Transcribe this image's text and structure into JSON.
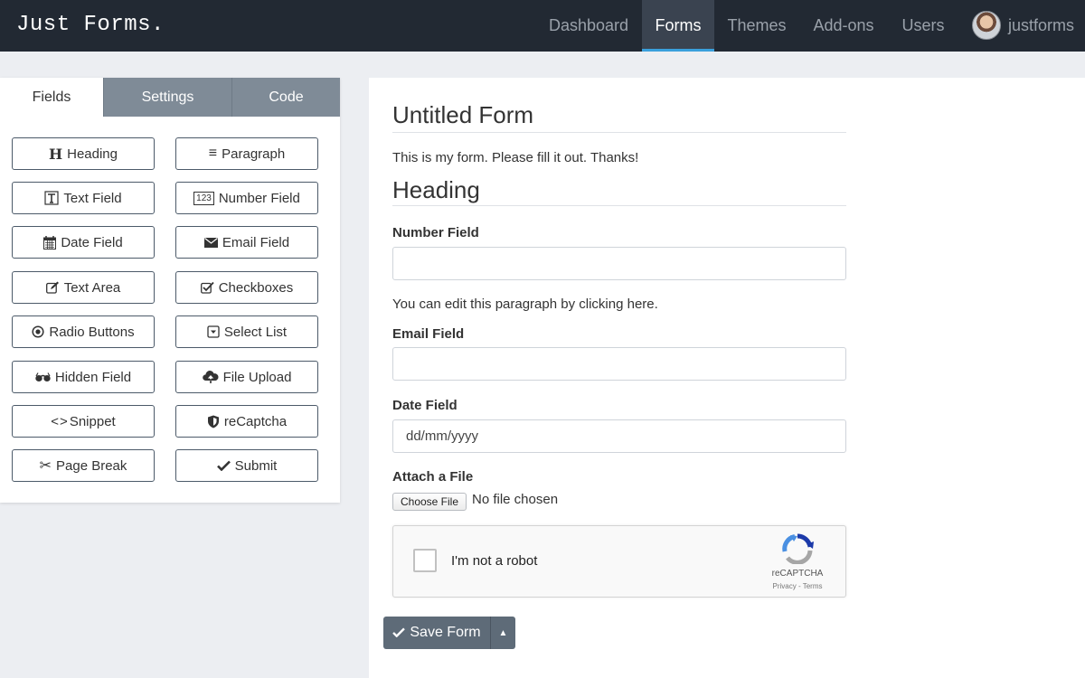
{
  "brand": "Just Forms.",
  "nav": {
    "items": [
      {
        "label": "Dashboard",
        "active": false
      },
      {
        "label": "Forms",
        "active": true
      },
      {
        "label": "Themes",
        "active": false
      },
      {
        "label": "Add-ons",
        "active": false
      },
      {
        "label": "Users",
        "active": false
      }
    ],
    "user": "justforms",
    "accent": "#3aa0dc"
  },
  "builder": {
    "tabs": [
      {
        "label": "Fields",
        "active": true
      },
      {
        "label": "Settings",
        "active": false
      },
      {
        "label": "Code",
        "active": false
      }
    ],
    "fields": [
      {
        "label": "Heading",
        "icon": "heading-icon"
      },
      {
        "label": "Paragraph",
        "icon": "paragraph-icon"
      },
      {
        "label": "Text Field",
        "icon": "text-field-icon"
      },
      {
        "label": "Number Field",
        "icon": "number-field-icon",
        "icon_text": "123"
      },
      {
        "label": "Date Field",
        "icon": "calendar-icon"
      },
      {
        "label": "Email Field",
        "icon": "envelope-icon"
      },
      {
        "label": "Text Area",
        "icon": "edit-icon"
      },
      {
        "label": "Checkboxes",
        "icon": "checkbox-icon"
      },
      {
        "label": "Radio Buttons",
        "icon": "radio-icon"
      },
      {
        "label": "Select List",
        "icon": "select-icon"
      },
      {
        "label": "Hidden Field",
        "icon": "glasses-icon"
      },
      {
        "label": "File Upload",
        "icon": "cloud-upload-icon"
      },
      {
        "label": "Snippet",
        "icon": "code-icon",
        "icon_text": "<>"
      },
      {
        "label": "reCaptcha",
        "icon": "shield-icon"
      },
      {
        "label": "Page Break",
        "icon": "scissors-icon"
      },
      {
        "label": "Submit",
        "icon": "check-icon"
      }
    ]
  },
  "form": {
    "title": "Untitled Form",
    "description": "This is my form. Please fill it out. Thanks!",
    "heading": "Heading",
    "number_label": "Number Field",
    "number_value": "",
    "paragraph": "You can edit this paragraph by clicking here.",
    "email_label": "Email Field",
    "email_value": "",
    "date_label": "Date Field",
    "date_placeholder": "dd/mm/yyyy",
    "file_label": "Attach a File",
    "choose_file": "Choose File",
    "no_file": "No file chosen",
    "captcha": {
      "text": "I'm not a robot",
      "brand": "reCAPTCHA",
      "links": "Privacy - Terms"
    },
    "save_label": "Save Form"
  }
}
